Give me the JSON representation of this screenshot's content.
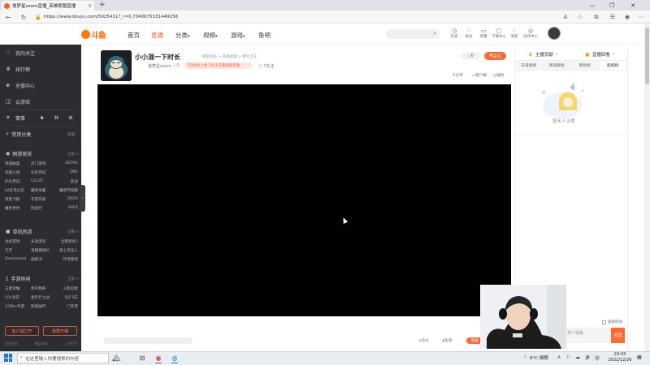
{
  "browser": {
    "tab_title": "嵬梦星zoom直播_英雄联盟直播",
    "tab_close": "×",
    "new_tab": "+",
    "url": "https://www.douyu.com/5925411?_r=0.7340675331449256",
    "window_controls": [
      "—",
      "❐",
      "✕"
    ]
  },
  "site": {
    "logo_text": "斗鱼",
    "nav": [
      "首页",
      "直播",
      "分类",
      "视频",
      "游戏",
      "鱼吧"
    ],
    "nav_dropdown_marker": "▾",
    "header_icons": [
      "历史",
      "关注",
      "开播",
      "下载中心",
      "消息",
      "创作中心"
    ]
  },
  "sidebar": {
    "top_items": [
      "我的关注",
      "排行榜",
      "充值中心",
      "云游戏"
    ],
    "icon_row": [
      "赛事"
    ],
    "common_section": {
      "title": "常用分类",
      "more": "管理"
    },
    "sections": [
      {
        "title": "网游竞技",
        "more": "全部 >",
        "items": [
          "英雄联盟",
          "热门游戏",
          "DOTA2",
          "穿越火线",
          "彩虹传说",
          "DNF",
          "炉石传说",
          "CS:GO",
          "逆战",
          "lol云顶之弈",
          "魔兽争霸",
          "魔兽怀旧服",
          "阿森卡斯",
          "守望先锋",
          "DOTA",
          "魔兽世界",
          "团战行",
          "APEX"
        ]
      },
      {
        "title": "单机热游",
        "more": "全部 >",
        "items": [
          "主机游戏",
          "永劫无间",
          "全用猎杀2",
          "元宇",
          "直播看相片",
          "海上突击人",
          "Overpowed",
          "超解决",
          "环境游戏"
        ]
      },
      {
        "title": "手游休闲",
        "more": "全部 >",
        "items": [
          "王者荣耀",
          "和平精英",
          "火影忍者",
          "LOL手游",
          "金铲铲之战",
          "QQ飞车",
          "CODm手游",
          "暗黑破坏",
          "门手游"
        ]
      }
    ],
    "buttons": [
      "客户端打开",
      "我要开播"
    ],
    "footer": [
      "家居发布",
      "精英联系",
      "人仔打仔"
    ],
    "collapse_glyph": "‹"
  },
  "room": {
    "title": "小小混一下时长",
    "breadcrumb": "网游竞技 > 英雄联盟 > 暂时上车",
    "streamer": "嵬梦星zoom",
    "heat": "0",
    "tag": "T行场比上场  2021年最爱看英雄",
    "fans": "7关注",
    "follow_count": "0",
    "follow_label": "关注",
    "actions": [
      "分享",
      "客户端",
      "福利"
    ]
  },
  "player_controls": [
    "鱼丸",
    "鱼翅"
  ],
  "send_gift": "赠送",
  "right_panel": {
    "top_tabs": [
      "主播贡献",
      "直播回看"
    ],
    "tabs": [
      "日贡献榜",
      "周贡献榜",
      "周榜榜",
      "超级榜"
    ],
    "empty_text": "暂无人上榜",
    "lock_scroll": "锁屏停动",
    "chat_placeholder": "发个弹幕",
    "send": "发送"
  },
  "taskbar": {
    "search_placeholder": "在这里输入你要搜索的内容",
    "weather": "6°C  晴朗",
    "time": "23:43",
    "date": "2022/12/26",
    "tray": [
      "∧",
      "⚐",
      "☁",
      "🔊",
      "中",
      "▦"
    ]
  },
  "colors": {
    "accent": "#ff5d23",
    "sidebar_bg": "#2b2d31",
    "player_bg": "#000000"
  }
}
